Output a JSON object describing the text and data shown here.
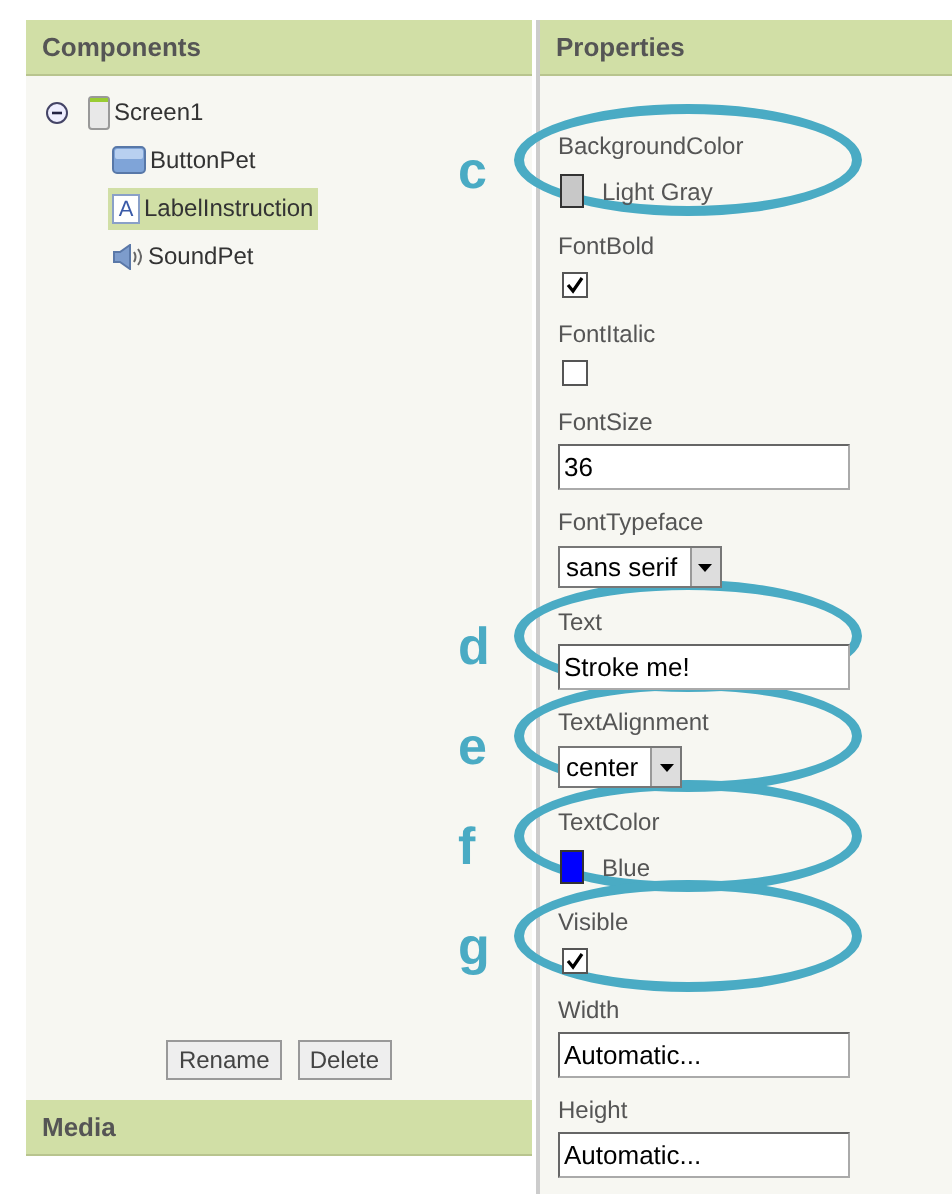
{
  "components": {
    "title": "Components",
    "tree": [
      {
        "name": "Screen1",
        "kind": "screen",
        "expanded": true,
        "selected": false,
        "children": [
          {
            "name": "ButtonPet",
            "kind": "button",
            "selected": false
          },
          {
            "name": "LabelInstruction",
            "kind": "label",
            "glyph": "A",
            "selected": true
          },
          {
            "name": "SoundPet",
            "kind": "sound",
            "selected": false
          }
        ]
      }
    ],
    "buttons": [
      "Rename",
      "Delete"
    ]
  },
  "media": {
    "title": "Media"
  },
  "properties": {
    "title": "Properties",
    "items": [
      {
        "kind": "color",
        "label": "BackgroundColor",
        "value": "Light Gray",
        "color": "#c8c8c8",
        "annotation": "c"
      },
      {
        "kind": "checkbox",
        "label": "FontBold",
        "checked": true
      },
      {
        "kind": "checkbox",
        "label": "FontItalic",
        "checked": false
      },
      {
        "kind": "text",
        "label": "FontSize",
        "value": "36"
      },
      {
        "kind": "dropdown",
        "label": "FontTypeface",
        "value": "sans serif"
      },
      {
        "kind": "text",
        "label": "Text",
        "value": "Stroke me!",
        "annotation": "d"
      },
      {
        "kind": "dropdown",
        "label": "TextAlignment",
        "value": "center",
        "annotation": "e"
      },
      {
        "kind": "color",
        "label": "TextColor",
        "value": "Blue",
        "color": "#0000ff",
        "annotation": "f"
      },
      {
        "kind": "checkbox",
        "label": "Visible",
        "checked": true,
        "annotation": "g"
      },
      {
        "kind": "text",
        "label": "Width",
        "value": "Automatic..."
      },
      {
        "kind": "text",
        "label": "Height",
        "value": "Automatic..."
      }
    ]
  }
}
